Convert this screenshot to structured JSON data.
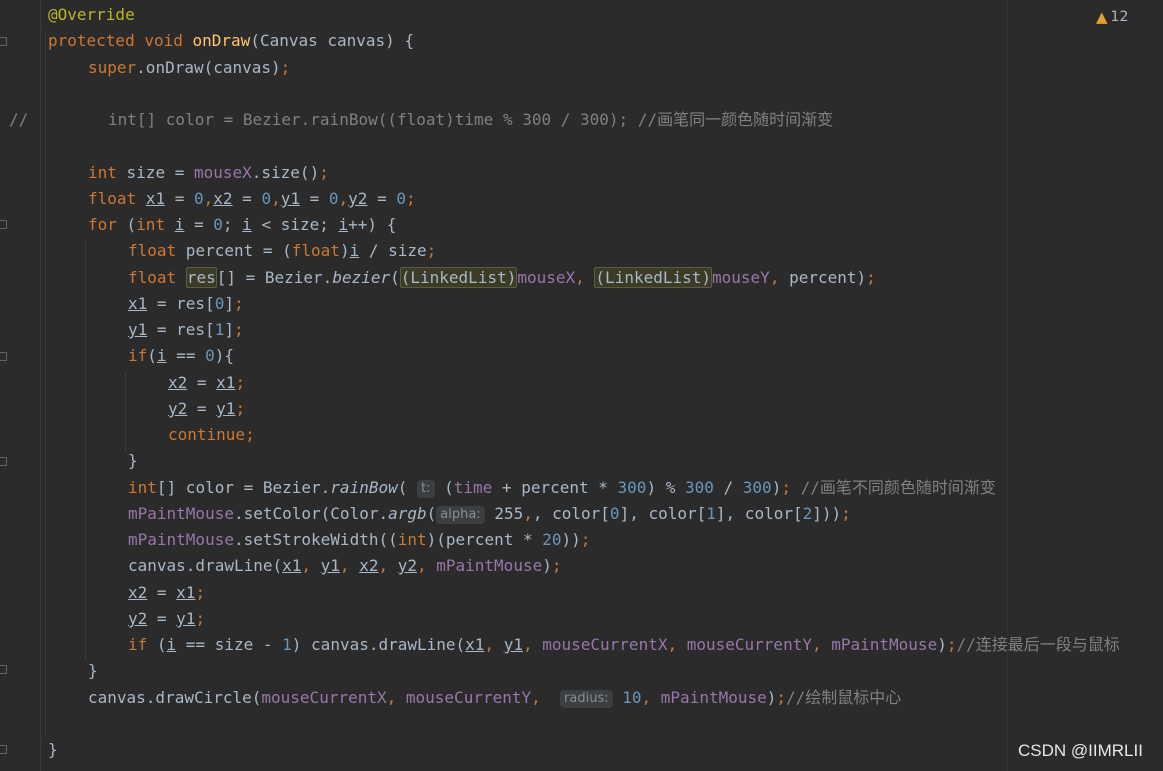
{
  "editor": {
    "warning_count": "12",
    "warning_icon": "warning-triangle-icon",
    "gutter_comment_marker": "//"
  },
  "code": {
    "l1_override": "@Override",
    "l2_protected": "protected",
    "l2_void": "void",
    "l2_name": "onDraw",
    "l2_params": "(Canvas canvas) {",
    "l3_super": "super",
    "l3_rest": ".onDraw(canvas)",
    "semi": ";",
    "l4_commented": "int[] color = Bezier.rainBow((float)time % 300 / 300); //画笔同一颜色随时间渐变",
    "l5_int": "int",
    "l5_mid": " size = ",
    "l5_field": "mouseX",
    "l5_end": ".size()",
    "l6_float": "float",
    "l6_x1": "x1",
    "l6_eq": " = ",
    "l6_zero": "0",
    "l6_x2": "x2",
    "l6_y1": "y1",
    "l6_y2": "y2",
    "l7_for": "for",
    "l7_open": " (",
    "l7_int": "int",
    "l7_i": "i",
    "l7_eq0": " = ",
    "l7_zero": "0",
    "l7_lt": "; ",
    "l7_i2": "i",
    "l7_size": " < size; ",
    "l7_i3": "i",
    "l7_end": "++) {",
    "l8_float": "float",
    "l8_mid": " percent = (",
    "l8_float2": "float",
    "l8_close": ")",
    "l8_i": "i",
    "l8_end": " / size",
    "l9_float": "float",
    "l9_res": "res",
    "l9_mid": "[] = Bezier.",
    "l9_bezier": "bezier",
    "l9_ll1": "(LinkedList)",
    "l9_mx": "mouseX",
    "l9_ll2": "(LinkedList)",
    "l9_my": "mouseY",
    "l9_end": " percent)",
    "l10_x1": "x1",
    "l10_mid": " = res[",
    "l10_zero": "0",
    "l10_end": "]",
    "l11_y1": "y1",
    "l11_mid": " = res[",
    "l11_one": "1",
    "l11_end": "]",
    "l12_if": "if",
    "l12_open": "(",
    "l12_i": "i",
    "l12_mid": " == ",
    "l12_zero": "0",
    "l12_end": "){",
    "l13_x2": "x2",
    "l13_mid": " = ",
    "l13_x1": "x1",
    "l14_y2": "y2",
    "l14_mid": " = ",
    "l14_y1": "y1",
    "l15_continue": "continue",
    "l16_close": "}",
    "l17_int": "int",
    "l17_mid": "[] color = Bezier.",
    "l17_fn": "rainBow",
    "l17_open": "(",
    "l17_hint": "t:",
    "l17_a": " (",
    "l17_time": "time",
    "l17_b": " + percent * ",
    "l17_300a": "300",
    "l17_c": ") % ",
    "l17_300b": "300",
    "l17_d": " / ",
    "l17_300c": "300",
    "l17_e": ")",
    "l17_cmt": "//画笔不同颜色随时间渐变",
    "l18_paint": "mPaintMouse",
    "l18_mid": ".setColor(Color.",
    "l18_argb": "argb",
    "l18_open": "(",
    "l18_hint": "alpha:",
    "l18_255": " 255",
    "l18_c1": ", color[",
    "l18_0": "0",
    "l18_c2": "], color[",
    "l18_1": "1",
    "l18_c3": "], color[",
    "l18_2": "2",
    "l18_end": "]))",
    "l19_paint": "mPaintMouse",
    "l19_mid": ".setStrokeWidth((",
    "l19_int": "int",
    "l19_b": ")(percent * ",
    "l19_20": "20",
    "l19_end": "))",
    "l20_start": "canvas.drawLine(",
    "l20_x1": "x1",
    "l20_y1": "y1",
    "l20_x2": "x2",
    "l20_y2": "y2",
    "l20_paint": "mPaintMouse",
    "l20_end": ")",
    "comma": ", ",
    "l21_x2": "x2",
    "l21_mid": " = ",
    "l21_x1": "x1",
    "l22_y2": "y2",
    "l22_mid": " = ",
    "l22_y1": "y1",
    "l23_if": "if",
    "l23_open": " (",
    "l23_i": "i",
    "l23_mid": " == size - ",
    "l23_one": "1",
    "l23_call": ") canvas.drawLine(",
    "l23_x1": "x1",
    "l23_y1": "y1",
    "l23_mcx": "mouseCurrentX",
    "l23_mcy": "mouseCurrentY",
    "l23_paint": "mPaintMouse",
    "l23_end": ")",
    "l23_cmt": "//连接最后一段与鼠标",
    "l24_close": "}",
    "l25_start": "canvas.drawCircle(",
    "l25_mcx": "mouseCurrentX",
    "l25_mcy": "mouseCurrentY",
    "l25_hint": "radius:",
    "l25_10": " 10",
    "l25_paint": "mPaintMouse",
    "l25_end": ")",
    "l25_cmt": "//绘制鼠标中心",
    "l27_close": "}"
  },
  "watermark": "CSDN @IIMRLII"
}
